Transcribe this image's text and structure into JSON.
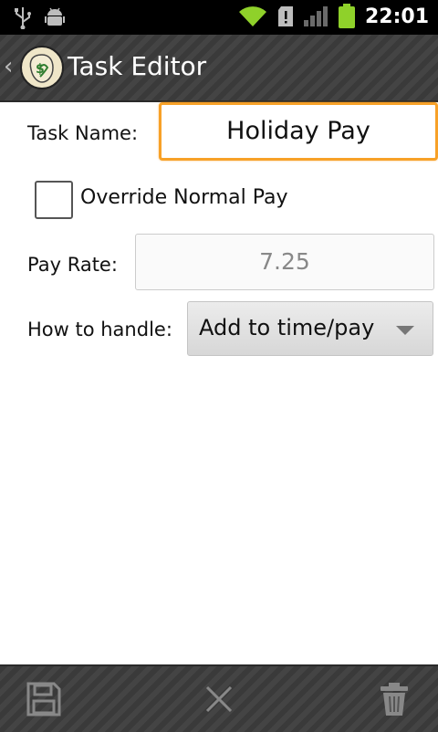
{
  "status_bar": {
    "time": "22:01",
    "icons": [
      "usb-icon",
      "android-debug-icon",
      "wifi-icon",
      "sd-card-icon",
      "signal-icon",
      "battery-icon"
    ]
  },
  "action_bar": {
    "back_glyph": "‹",
    "title": "Task Editor"
  },
  "form": {
    "task_name_label": "Task Name:",
    "task_name_value": "Holiday Pay",
    "override_label": "Override Normal Pay",
    "override_checked": false,
    "pay_rate_label": "Pay Rate:",
    "pay_rate_value": "7.25",
    "handle_label": "How to handle:",
    "handle_value": "Add to time/pay"
  },
  "bottom_bar": {
    "actions": [
      "save-icon",
      "cancel-icon",
      "delete-icon"
    ]
  },
  "colors": {
    "focus_accent": "#f7a128",
    "actionbar": "#3a3a3a",
    "battery": "#8fd12a",
    "wifi": "#8fd12a"
  }
}
